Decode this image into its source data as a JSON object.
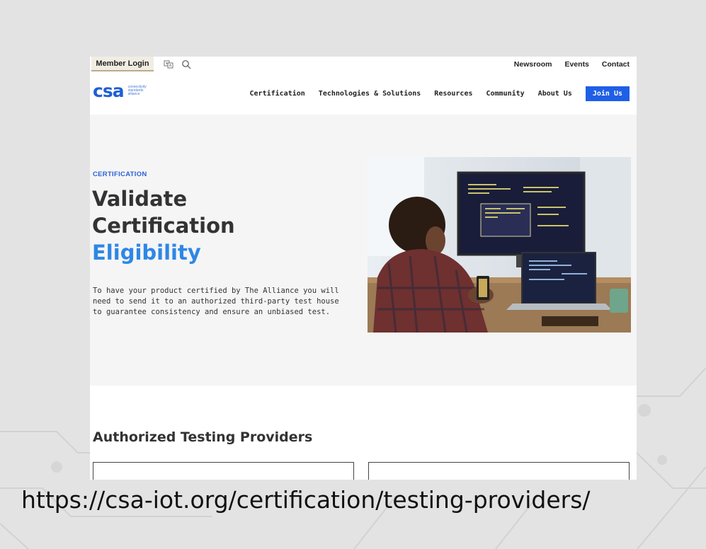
{
  "topbar": {
    "member_login": "Member Login",
    "links": [
      "Newsroom",
      "Events",
      "Contact"
    ]
  },
  "nav": {
    "logo_mark": "csa",
    "logo_text": [
      "connectivity",
      "standards",
      "alliance"
    ],
    "items": [
      "Certification",
      "Technologies & Solutions",
      "Resources",
      "Community",
      "About Us"
    ],
    "join_label": "Join Us"
  },
  "hero": {
    "eyebrow": "CERTIFICATION",
    "title_line1": "Validate",
    "title_line2": "Certification",
    "title_line3": "Eligibility",
    "body": "To have your product certified by The Alliance you will need to send it to an authorized third-party test house to guarantee consistency and ensure an unbiased test."
  },
  "providers": {
    "heading": "Authorized Testing Providers"
  },
  "caption": {
    "url": "https://csa-iot.org/certification/testing-providers/"
  },
  "icons": {
    "translate": "translate-icon",
    "search": "search-icon"
  },
  "colors": {
    "accent": "#1f5fe6",
    "highlight": "#2e87e6",
    "page_bg": "#e3e3e3"
  }
}
